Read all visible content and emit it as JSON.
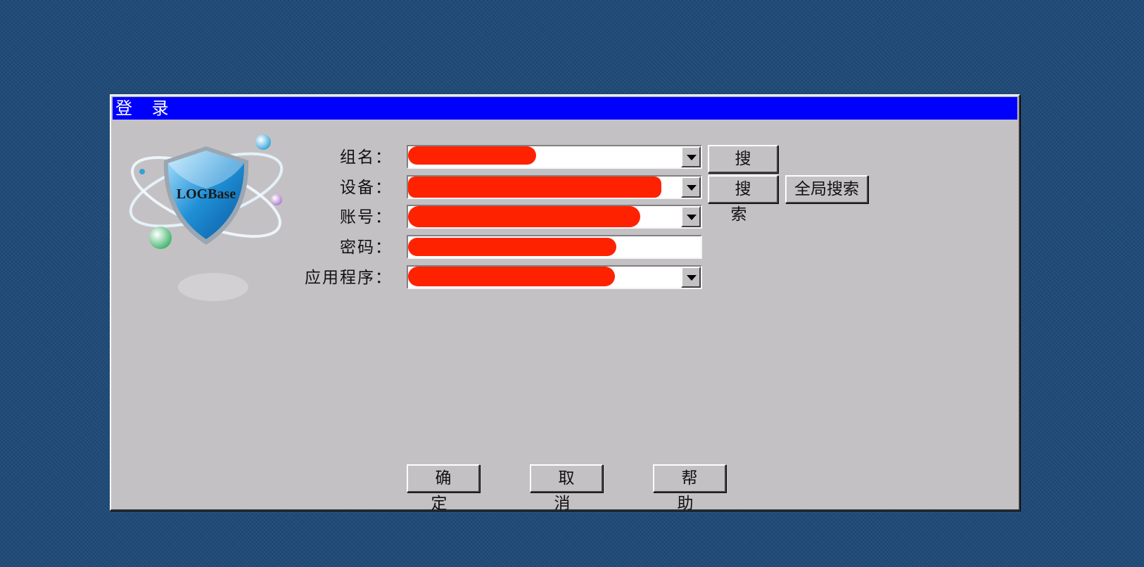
{
  "window": {
    "title": "登 录"
  },
  "logo": {
    "text": "LOGBase",
    "icon": "logbase-shield-logo"
  },
  "form": {
    "group_label": "组名：",
    "group_value": "",
    "device_label": "设备：",
    "device_value": "",
    "account_label": "账号：",
    "account_value": "",
    "password_label": "密码：",
    "password_value": "",
    "app_label": "应用程序：",
    "app_value": ""
  },
  "buttons": {
    "search_group": "搜 索",
    "search_device": "搜 索",
    "global_search": "全局搜索",
    "ok": "确 定",
    "cancel": "取 消",
    "help": "帮 助"
  },
  "colors": {
    "titlebar": "#0000ff",
    "dialog_bg": "#c4c1c4",
    "desktop_bg": "#1f4a78",
    "redaction": "#ff2200"
  }
}
